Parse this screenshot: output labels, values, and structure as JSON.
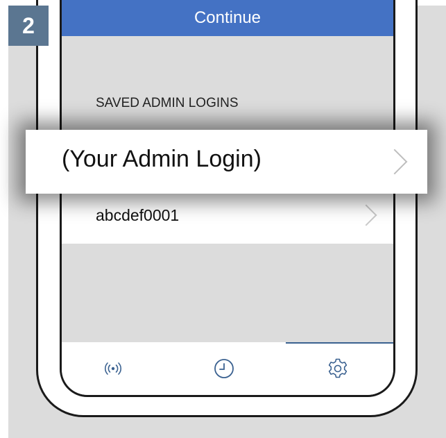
{
  "step": {
    "number": "2"
  },
  "screen": {
    "continue_label": "Continue",
    "section_label": "SAVED ADMIN LOGINS",
    "logins": [
      {
        "label": "(Your Admin Login)",
        "highlighted": true
      },
      {
        "label": "abcdef0001",
        "highlighted": false
      }
    ]
  },
  "tab_bar": {
    "tabs": [
      {
        "icon": "broadcast-icon",
        "active": false
      },
      {
        "icon": "clock-icon",
        "active": false
      },
      {
        "icon": "gear-icon",
        "active": true
      }
    ]
  },
  "colors": {
    "accent": "#4472c4",
    "badge": "#5b7691",
    "panel_bg": "#dcdcdc",
    "tab_icon": "#3a6190"
  }
}
